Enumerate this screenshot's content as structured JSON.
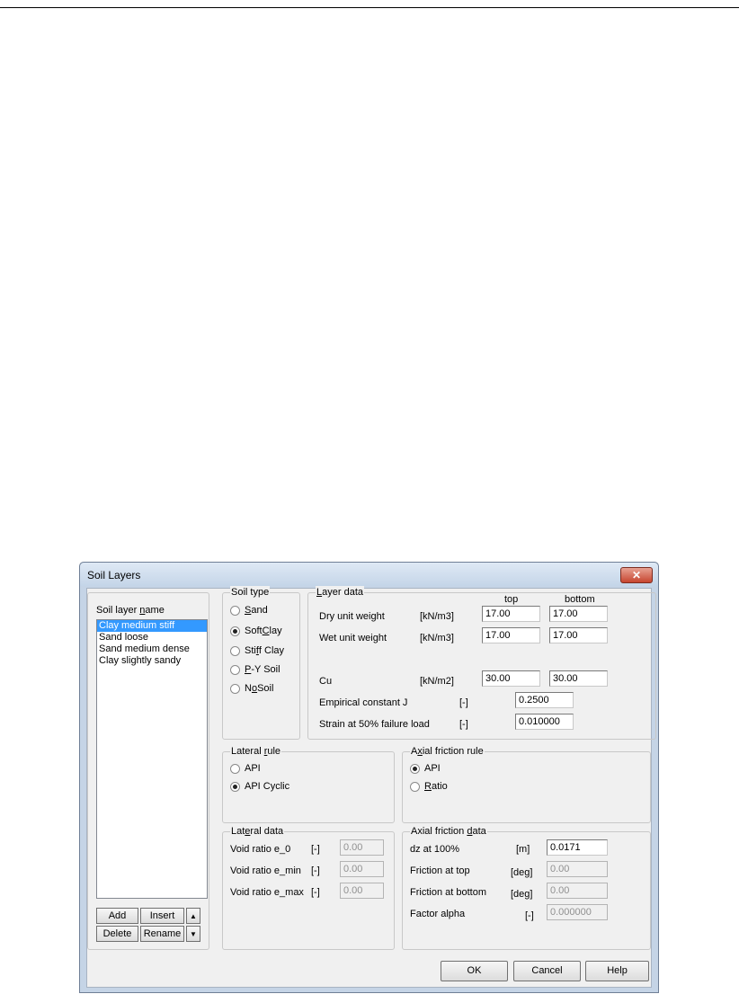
{
  "window": {
    "title": "Soil Layers",
    "close_icon": "close-icon"
  },
  "soil_layers": {
    "label_pre": "Soil layer ",
    "label_key": "n",
    "label_post": "ame",
    "items": [
      {
        "name": "Clay medium stiff",
        "selected": true
      },
      {
        "name": "Sand loose"
      },
      {
        "name": "Sand medium dense"
      },
      {
        "name": "Clay slightly sandy"
      }
    ],
    "buttons": {
      "add": "Add",
      "insert": "Insert",
      "delete": "Delete",
      "rename": "Rename",
      "up_icon": "arrow-up-icon",
      "down_icon": "arrow-down-icon"
    }
  },
  "soil_type": {
    "title": "Soil type",
    "options": [
      {
        "pre": "",
        "key": "S",
        "post": "and",
        "checked": false
      },
      {
        "pre": "Soft ",
        "key": "C",
        "post": "lay",
        "checked": true
      },
      {
        "pre": "Sti",
        "key": "f",
        "post": "f Clay",
        "checked": false
      },
      {
        "pre": "",
        "key": "P",
        "post": "-Y Soil",
        "checked": false
      },
      {
        "pre": "N",
        "key": "o",
        "post": " Soil",
        "checked": false
      }
    ]
  },
  "layer_data": {
    "title_key": "L",
    "title_post": "ayer data",
    "col_top": "top",
    "col_bottom": "bottom",
    "rows": [
      {
        "label": "Dry unit weight",
        "unit": "[kN/m3]",
        "top": "17.00",
        "bottom": "17.00"
      },
      {
        "label": "Wet unit weight",
        "unit": "[kN/m3]",
        "top": "17.00",
        "bottom": "17.00"
      },
      {
        "label": "Cu",
        "unit": "[kN/m2]",
        "top": "30.00",
        "bottom": "30.00"
      }
    ],
    "j": {
      "label": "Empirical constant J",
      "unit": "[-]",
      "value": "0.2500"
    },
    "strain": {
      "label": "Strain at 50% failure load",
      "unit": "[-]",
      "value": "0.010000"
    }
  },
  "lateral_rule": {
    "title_pre": "Lateral ",
    "title_key": "r",
    "title_post": "ule",
    "options": [
      {
        "label": "API",
        "checked": false
      },
      {
        "label": "API Cyclic",
        "checked": true
      }
    ]
  },
  "axial_friction_rule": {
    "title_pre": "A",
    "title_key": "x",
    "title_post": "ial friction rule",
    "options": [
      {
        "pre": "",
        "key": "",
        "post": "API",
        "checked": true
      },
      {
        "pre": "",
        "key": "R",
        "post": "atio",
        "checked": false
      }
    ]
  },
  "lateral_data": {
    "title_pre": "Lat",
    "title_key": "e",
    "title_post": "ral data",
    "rows": [
      {
        "label": "Void ratio e_0",
        "unit": "[-]",
        "value": "0.00"
      },
      {
        "label": "Void ratio e_min",
        "unit": "[-]",
        "value": "0.00"
      },
      {
        "label": "Void ratio e_max",
        "unit": "[-]",
        "value": "0.00"
      }
    ]
  },
  "axial_friction_data": {
    "title_pre": "Axial friction ",
    "title_key": "d",
    "title_post": "ata",
    "rows": [
      {
        "label": "dz at 100%",
        "unit": "[m]",
        "value": "0.0171",
        "disabled": false
      },
      {
        "label": "Friction at top",
        "unit": "[deg]",
        "value": "0.00",
        "disabled": true
      },
      {
        "label": "Friction at bottom",
        "unit": "[deg]",
        "value": "0.00",
        "disabled": true
      },
      {
        "label": "Factor alpha",
        "unit": "[-]",
        "value": "0.000000",
        "disabled": true
      }
    ]
  },
  "footer": {
    "ok": "OK",
    "cancel": "Cancel",
    "help": "Help"
  }
}
